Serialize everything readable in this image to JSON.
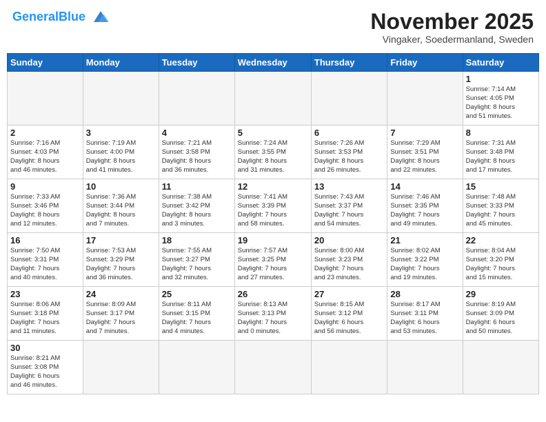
{
  "header": {
    "logo_general": "General",
    "logo_blue": "Blue",
    "month_title": "November 2025",
    "location": "Vingaker, Soedermanland, Sweden"
  },
  "weekdays": [
    "Sunday",
    "Monday",
    "Tuesday",
    "Wednesday",
    "Thursday",
    "Friday",
    "Saturday"
  ],
  "weeks": [
    [
      {
        "day": "",
        "info": ""
      },
      {
        "day": "",
        "info": ""
      },
      {
        "day": "",
        "info": ""
      },
      {
        "day": "",
        "info": ""
      },
      {
        "day": "",
        "info": ""
      },
      {
        "day": "",
        "info": ""
      },
      {
        "day": "1",
        "info": "Sunrise: 7:14 AM\nSunset: 4:05 PM\nDaylight: 8 hours\nand 51 minutes."
      }
    ],
    [
      {
        "day": "2",
        "info": "Sunrise: 7:16 AM\nSunset: 4:03 PM\nDaylight: 8 hours\nand 46 minutes."
      },
      {
        "day": "3",
        "info": "Sunrise: 7:19 AM\nSunset: 4:00 PM\nDaylight: 8 hours\nand 41 minutes."
      },
      {
        "day": "4",
        "info": "Sunrise: 7:21 AM\nSunset: 3:58 PM\nDaylight: 8 hours\nand 36 minutes."
      },
      {
        "day": "5",
        "info": "Sunrise: 7:24 AM\nSunset: 3:55 PM\nDaylight: 8 hours\nand 31 minutes."
      },
      {
        "day": "6",
        "info": "Sunrise: 7:26 AM\nSunset: 3:53 PM\nDaylight: 8 hours\nand 26 minutes."
      },
      {
        "day": "7",
        "info": "Sunrise: 7:29 AM\nSunset: 3:51 PM\nDaylight: 8 hours\nand 22 minutes."
      },
      {
        "day": "8",
        "info": "Sunrise: 7:31 AM\nSunset: 3:48 PM\nDaylight: 8 hours\nand 17 minutes."
      }
    ],
    [
      {
        "day": "9",
        "info": "Sunrise: 7:33 AM\nSunset: 3:46 PM\nDaylight: 8 hours\nand 12 minutes."
      },
      {
        "day": "10",
        "info": "Sunrise: 7:36 AM\nSunset: 3:44 PM\nDaylight: 8 hours\nand 7 minutes."
      },
      {
        "day": "11",
        "info": "Sunrise: 7:38 AM\nSunset: 3:42 PM\nDaylight: 8 hours\nand 3 minutes."
      },
      {
        "day": "12",
        "info": "Sunrise: 7:41 AM\nSunset: 3:39 PM\nDaylight: 7 hours\nand 58 minutes."
      },
      {
        "day": "13",
        "info": "Sunrise: 7:43 AM\nSunset: 3:37 PM\nDaylight: 7 hours\nand 54 minutes."
      },
      {
        "day": "14",
        "info": "Sunrise: 7:46 AM\nSunset: 3:35 PM\nDaylight: 7 hours\nand 49 minutes."
      },
      {
        "day": "15",
        "info": "Sunrise: 7:48 AM\nSunset: 3:33 PM\nDaylight: 7 hours\nand 45 minutes."
      }
    ],
    [
      {
        "day": "16",
        "info": "Sunrise: 7:50 AM\nSunset: 3:31 PM\nDaylight: 7 hours\nand 40 minutes."
      },
      {
        "day": "17",
        "info": "Sunrise: 7:53 AM\nSunset: 3:29 PM\nDaylight: 7 hours\nand 36 minutes."
      },
      {
        "day": "18",
        "info": "Sunrise: 7:55 AM\nSunset: 3:27 PM\nDaylight: 7 hours\nand 32 minutes."
      },
      {
        "day": "19",
        "info": "Sunrise: 7:57 AM\nSunset: 3:25 PM\nDaylight: 7 hours\nand 27 minutes."
      },
      {
        "day": "20",
        "info": "Sunrise: 8:00 AM\nSunset: 3:23 PM\nDaylight: 7 hours\nand 23 minutes."
      },
      {
        "day": "21",
        "info": "Sunrise: 8:02 AM\nSunset: 3:22 PM\nDaylight: 7 hours\nand 19 minutes."
      },
      {
        "day": "22",
        "info": "Sunrise: 8:04 AM\nSunset: 3:20 PM\nDaylight: 7 hours\nand 15 minutes."
      }
    ],
    [
      {
        "day": "23",
        "info": "Sunrise: 8:06 AM\nSunset: 3:18 PM\nDaylight: 7 hours\nand 11 minutes."
      },
      {
        "day": "24",
        "info": "Sunrise: 8:09 AM\nSunset: 3:17 PM\nDaylight: 7 hours\nand 7 minutes."
      },
      {
        "day": "25",
        "info": "Sunrise: 8:11 AM\nSunset: 3:15 PM\nDaylight: 7 hours\nand 4 minutes."
      },
      {
        "day": "26",
        "info": "Sunrise: 8:13 AM\nSunset: 3:13 PM\nDaylight: 7 hours\nand 0 minutes."
      },
      {
        "day": "27",
        "info": "Sunrise: 8:15 AM\nSunset: 3:12 PM\nDaylight: 6 hours\nand 56 minutes."
      },
      {
        "day": "28",
        "info": "Sunrise: 8:17 AM\nSunset: 3:11 PM\nDaylight: 6 hours\nand 53 minutes."
      },
      {
        "day": "29",
        "info": "Sunrise: 8:19 AM\nSunset: 3:09 PM\nDaylight: 6 hours\nand 50 minutes."
      }
    ],
    [
      {
        "day": "30",
        "info": "Sunrise: 8:21 AM\nSunset: 3:08 PM\nDaylight: 6 hours\nand 46 minutes."
      },
      {
        "day": "",
        "info": ""
      },
      {
        "day": "",
        "info": ""
      },
      {
        "day": "",
        "info": ""
      },
      {
        "day": "",
        "info": ""
      },
      {
        "day": "",
        "info": ""
      },
      {
        "day": "",
        "info": ""
      }
    ]
  ]
}
